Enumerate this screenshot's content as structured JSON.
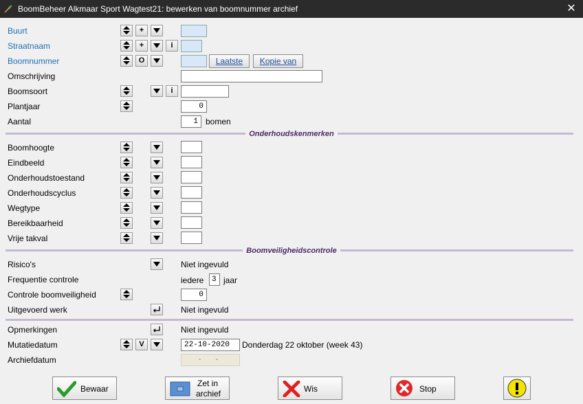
{
  "window": {
    "title": "BoomBeheer Alkmaar Sport Wagtest21: bewerken van boomnummer archief",
    "close": "✕"
  },
  "fields": {
    "buurt": "Buurt",
    "straatnaam": "Straatnaam",
    "boomnummer": "Boomnummer",
    "omschrijving": "Omschrijving",
    "boomsoort": "Boomsoort",
    "plantjaar": "Plantjaar",
    "plantjaar_value": "0",
    "aantal": "Aantal",
    "aantal_value": "1",
    "aantal_unit": "bomen"
  },
  "buttons": {
    "laatste": "Laatste",
    "kopie": "Kopie van",
    "plus": "+",
    "info": "i",
    "o": "O",
    "v": "V"
  },
  "onderhoud": {
    "header": "Onderhoudskenmerken",
    "boomhoogte": "Boomhoogte",
    "eindbeeld": "Eindbeeld",
    "onderhoudstoestand": "Onderhoudstoestand",
    "onderhoudscyclus": "Onderhoudscyclus",
    "wegtype": "Wegtype",
    "bereikbaarheid": "Bereikbaarheid",
    "vrije_takval": "Vrije takval"
  },
  "veiligheid": {
    "header": "Boomveiligheidscontrole",
    "risicos": "Risico's",
    "risicos_value": "Niet ingevuld",
    "frequentie": "Frequentie controle",
    "frequentie_pre": "iedere",
    "frequentie_value": "3",
    "frequentie_post": "jaar",
    "controle": "Controle boomveiligheid",
    "controle_value": "0",
    "uitgevoerd": "Uitgevoerd werk",
    "uitgevoerd_value": "Niet ingevuld"
  },
  "overig": {
    "opmerkingen": "Opmerkingen",
    "opmerkingen_value": "Niet ingevuld",
    "mutatiedatum": "Mutatiedatum",
    "mutatiedatum_value": "22-10-2020",
    "mutatiedatum_text": "Donderdag 22 oktober (week 43)",
    "archiefdatum": "Archiefdatum",
    "archiefdatum_value": "- -"
  },
  "actions": {
    "bewaar": "Bewaar",
    "zet_line1": "Zet in",
    "zet_line2": "archief",
    "wis": "Wis",
    "stop": "Stop"
  }
}
